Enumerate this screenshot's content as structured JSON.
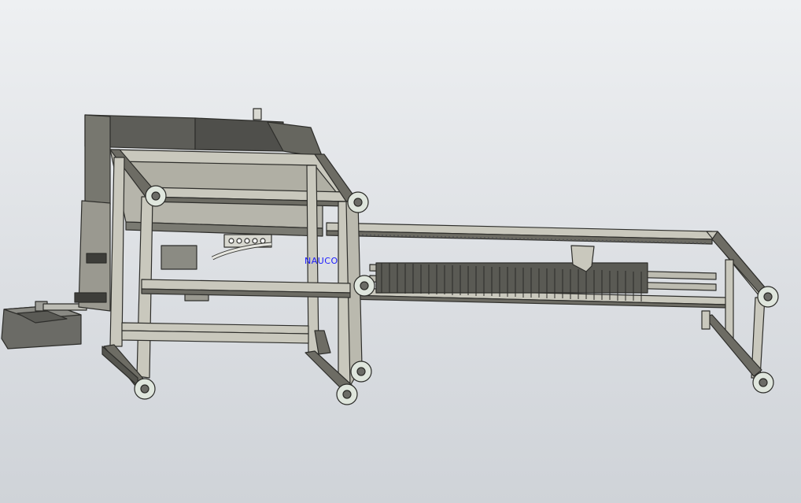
{
  "scene": {
    "annotation_label": "NAUCO",
    "background_top": "#eef0f2",
    "background_bottom": "#cfd3d8",
    "frame_color": "#c9c8bd",
    "frame_dark": "#4a4a45",
    "panel_dark": "#55554f",
    "wheel_color": "#dfe6dd",
    "annotation_color": "#1a1aff"
  }
}
